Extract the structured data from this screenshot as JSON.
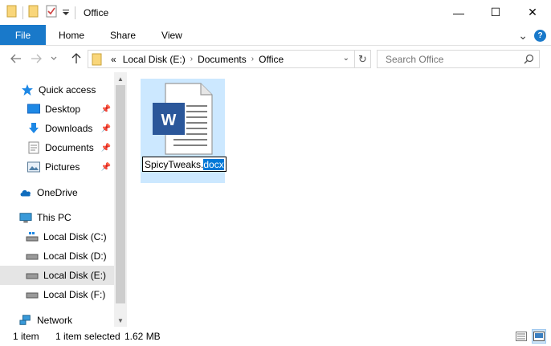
{
  "window": {
    "title": "Office",
    "minimize_glyph": "—",
    "maximize_glyph": "☐",
    "close_glyph": "✕"
  },
  "quick_access_toolbar": {
    "icons": [
      "folder-icon",
      "new-folder-icon",
      "properties-icon",
      "customize-dropdown-icon"
    ]
  },
  "ribbon": {
    "tabs": [
      {
        "label": "File",
        "active": true
      },
      {
        "label": "Home"
      },
      {
        "label": "Share"
      },
      {
        "label": "View"
      }
    ],
    "expand_glyph": "⌄",
    "help_glyph": "?"
  },
  "address_bar": {
    "overflow": "«",
    "breadcrumbs": [
      "Local Disk (E:)",
      "Documents",
      "Office"
    ],
    "separator": "›",
    "refresh_glyph": "↻"
  },
  "search": {
    "placeholder": "Search Office"
  },
  "navigation_pane": {
    "items": [
      {
        "label": "Quick access",
        "icon": "star-icon",
        "pinned": false
      },
      {
        "label": "Desktop",
        "icon": "desktop-icon",
        "pinned": true
      },
      {
        "label": "Downloads",
        "icon": "download-icon",
        "pinned": true
      },
      {
        "label": "Documents",
        "icon": "documents-icon",
        "pinned": true
      },
      {
        "label": "Pictures",
        "icon": "pictures-icon",
        "pinned": true
      },
      {
        "label": "OneDrive",
        "icon": "cloud-icon",
        "pinned": false
      },
      {
        "label": "This PC",
        "icon": "computer-icon",
        "pinned": false
      },
      {
        "label": "Local Disk (C:)",
        "icon": "system-drive-icon",
        "pinned": false
      },
      {
        "label": "Local Disk (D:)",
        "icon": "drive-icon",
        "pinned": false
      },
      {
        "label": "Local Disk (E:)",
        "icon": "drive-icon",
        "pinned": false,
        "selected": true
      },
      {
        "label": "Local Disk (F:)",
        "icon": "drive-icon",
        "pinned": false
      },
      {
        "label": "Network",
        "icon": "network-icon",
        "pinned": false
      }
    ]
  },
  "content": {
    "file": {
      "icon": "word-document-icon",
      "icon_letter": "W",
      "rename_base": "SpicyTweaks.",
      "rename_selected": "docx"
    }
  },
  "status_bar": {
    "item_count": "1 item",
    "selected": "1 item selected",
    "size": "1.62 MB"
  },
  "colors": {
    "accent": "#1979ca",
    "selection": "#cce8ff",
    "text_selection": "#0078d7",
    "word_blue": "#2b579a"
  }
}
